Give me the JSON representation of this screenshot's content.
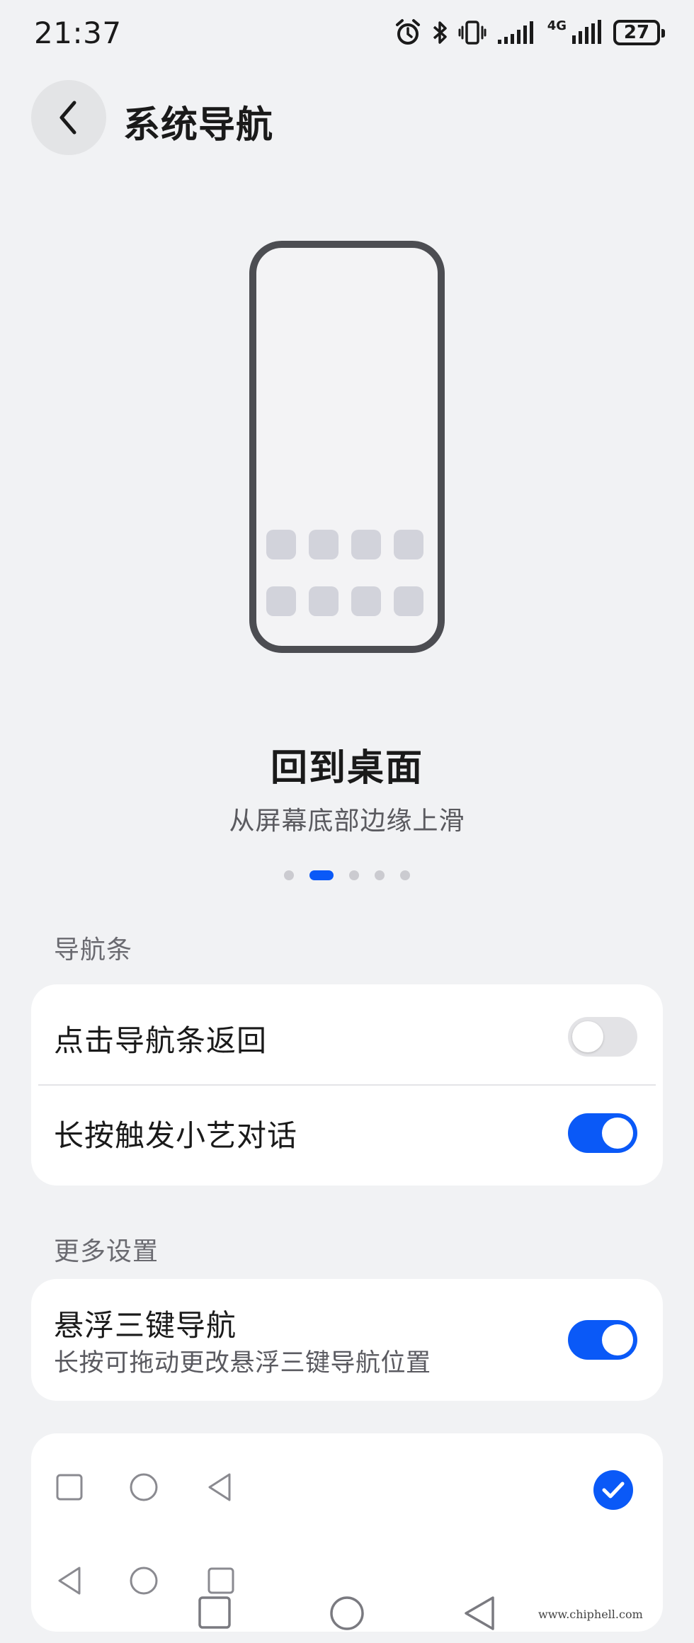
{
  "status_bar": {
    "time": "21:37",
    "network_label": "4G",
    "battery": "27",
    "icons": [
      "alarm-icon",
      "bluetooth-icon",
      "vibrate-icon",
      "signal-icon",
      "signal-4g-icon",
      "battery-icon"
    ]
  },
  "header": {
    "back_icon": "chevron-left-icon",
    "title": "系统导航"
  },
  "illustration": {
    "app_tile_count": 8
  },
  "gesture": {
    "title": "回到桌面",
    "subtitle": "从屏幕底部边缘上滑",
    "page_index": 1,
    "page_count": 5
  },
  "nav_bar_section": {
    "label": "导航条",
    "items": [
      {
        "label": "点击导航条返回",
        "enabled": false
      },
      {
        "label": "长按触发小艺对话",
        "enabled": true
      }
    ]
  },
  "more_section": {
    "label": "更多设置",
    "floating": {
      "title": "悬浮三键导航",
      "description": "长按可拖动更改悬浮三键导航位置",
      "enabled": true
    },
    "layouts": [
      {
        "icons": [
          "square-icon",
          "circle-icon",
          "triangle-back-icon"
        ],
        "selected": true
      },
      {
        "icons": [
          "triangle-back-icon",
          "circle-icon",
          "square-icon"
        ],
        "selected": false
      }
    ]
  },
  "system_nav": {
    "icons": [
      "square-icon",
      "circle-icon",
      "triangle-back-icon"
    ]
  },
  "watermark": "www.chiphell.com",
  "colors": {
    "accent": "#0a59f7",
    "background": "#f1f2f4",
    "card": "#ffffff"
  }
}
